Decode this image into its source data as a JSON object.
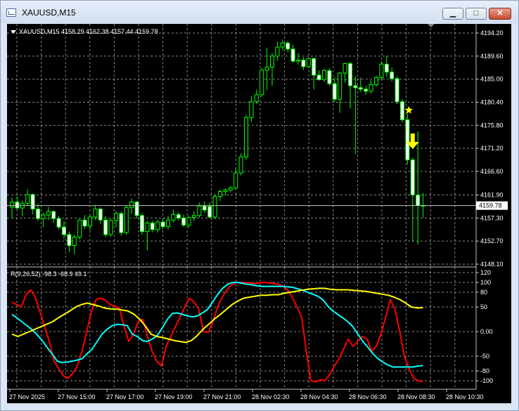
{
  "window": {
    "title": "XAUUSD,M15",
    "minimize_glyph": "▁",
    "maximize_glyph": "□",
    "close_glyph": "✕"
  },
  "chart_header": "XAUUSD,M15  4158.29 4162.38 4157.44 4159.78",
  "price_axis": {
    "ticks": [
      "4194.20",
      "4189.60",
      "4185.00",
      "4180.40",
      "4175.80",
      "4171.20",
      "4166.60",
      "4161.90",
      "4157.30",
      "4152.70",
      "4148.10"
    ],
    "current_price_label": "4159.78"
  },
  "indicator": {
    "label": "R(9,26,52) -98.3 -68.9 49.1",
    "ticks": [
      "120",
      "100",
      "80",
      "50",
      "0.00",
      "-50",
      "-80",
      "-100"
    ]
  },
  "time_axis": {
    "labels": [
      "27 Nov 2025",
      "27 Nov 15:00",
      "27 Nov 17:00",
      "27 Nov 19:00",
      "27 Nov 21:00",
      "28 Nov 02:30",
      "28 Nov 04:30",
      "28 Nov 06:30",
      "28 Nov 08:30",
      "28 Nov 10:30"
    ]
  },
  "colors": {
    "background": "#000000",
    "grid": "#c0c0c0",
    "candle": "#00ff00",
    "axis_text": "#ffffff",
    "line_fast": "#ff0000",
    "line_mid": "#00ffff",
    "line_slow": "#ffff00",
    "signal_marker": "#ffff00"
  },
  "chart_data": [
    {
      "type": "candlestick",
      "title": "XAUUSD,M15",
      "ylim": [
        4148.1,
        4194.2
      ],
      "current_price": 4159.78,
      "candles": [
        [
          4159.5,
          4161.4,
          4157.2,
          4160.5
        ],
        [
          4160.5,
          4161.6,
          4159.0,
          4159.3
        ],
        [
          4159.3,
          4160.8,
          4157.6,
          4160.2
        ],
        [
          4160.2,
          4163.0,
          4159.7,
          4162.0
        ],
        [
          4162.0,
          4162.2,
          4158.0,
          4159.1
        ],
        [
          4159.1,
          4160.1,
          4156.7,
          4157.2
        ],
        [
          4157.2,
          4158.4,
          4155.5,
          4157.9
        ],
        [
          4157.9,
          4159.5,
          4156.9,
          4158.6
        ],
        [
          4158.6,
          4158.9,
          4156.3,
          4157.2
        ],
        [
          4157.2,
          4157.8,
          4155.0,
          4155.5
        ],
        [
          4155.5,
          4156.7,
          4153.2,
          4154.0
        ],
        [
          4154.0,
          4154.6,
          4150.5,
          4151.8
        ],
        [
          4151.8,
          4154.0,
          4150.1,
          4153.5
        ],
        [
          4153.5,
          4157.1,
          4153.0,
          4156.9
        ],
        [
          4156.9,
          4157.9,
          4155.1,
          4155.7
        ],
        [
          4155.7,
          4158.0,
          4154.8,
          4157.5
        ],
        [
          4157.5,
          4159.9,
          4156.9,
          4159.1
        ],
        [
          4159.1,
          4159.4,
          4156.1,
          4156.9
        ],
        [
          4156.9,
          4157.7,
          4153.5,
          4154.0
        ],
        [
          4154.0,
          4157.2,
          4153.6,
          4156.8
        ],
        [
          4156.8,
          4158.7,
          4155.5,
          4158.2
        ],
        [
          4158.2,
          4158.6,
          4153.8,
          4154.4
        ],
        [
          4154.4,
          4159.9,
          4154.0,
          4159.4
        ],
        [
          4159.4,
          4161.2,
          4158.1,
          4160.5
        ],
        [
          4160.5,
          4160.7,
          4157.2,
          4157.8
        ],
        [
          4157.8,
          4158.3,
          4154.0,
          4154.6
        ],
        [
          4154.6,
          4156.7,
          4150.9,
          4156.3
        ],
        [
          4156.3,
          4156.8,
          4154.5,
          4155.0
        ],
        [
          4155.0,
          4157.0,
          4154.4,
          4156.5
        ],
        [
          4156.5,
          4157.2,
          4155.1,
          4155.6
        ],
        [
          4155.6,
          4157.7,
          4155.0,
          4156.9
        ],
        [
          4156.9,
          4159.0,
          4156.4,
          4158.0
        ],
        [
          4158.0,
          4158.5,
          4156.8,
          4157.3
        ],
        [
          4157.3,
          4158.0,
          4155.5,
          4155.9
        ],
        [
          4155.9,
          4157.8,
          4155.4,
          4157.4
        ],
        [
          4157.4,
          4158.7,
          4156.7,
          4157.8
        ],
        [
          4157.8,
          4160.4,
          4157.4,
          4159.7
        ],
        [
          4159.7,
          4160.6,
          4158.3,
          4158.9
        ],
        [
          4159.6,
          4160.4,
          4157.3,
          4157.5
        ],
        [
          4157.5,
          4162.0,
          4157.1,
          4161.6
        ],
        [
          4161.6,
          4163.0,
          4160.7,
          4162.6
        ],
        [
          4162.6,
          4163.2,
          4161.8,
          4162.9
        ],
        [
          4162.9,
          4163.7,
          4162.4,
          4163.3
        ],
        [
          4163.3,
          4167.2,
          4163.0,
          4166.3
        ],
        [
          4166.3,
          4170.2,
          4165.8,
          4169.5
        ],
        [
          4169.5,
          4177.9,
          4168.9,
          4177.3
        ],
        [
          4177.3,
          4181.6,
          4176.5,
          4180.5
        ],
        [
          4180.5,
          4182.9,
          4180.0,
          4181.9
        ],
        [
          4181.9,
          4187.2,
          4181.5,
          4186.8
        ],
        [
          4186.8,
          4191.3,
          4182.8,
          4187.4
        ],
        [
          4187.4,
          4190.2,
          4183.7,
          4189.6
        ],
        [
          4189.6,
          4192.5,
          4188.7,
          4191.4
        ],
        [
          4191.4,
          4192.9,
          4190.7,
          4192.2
        ],
        [
          4192.2,
          4192.6,
          4190.4,
          4191.0
        ],
        [
          4191.0,
          4191.8,
          4188.3,
          4188.6
        ],
        [
          4188.6,
          4190.2,
          4187.9,
          4188.8
        ],
        [
          4188.8,
          4189.4,
          4186.8,
          4187.5
        ],
        [
          4187.5,
          4189.4,
          4187.2,
          4189.1
        ],
        [
          4189.1,
          4189.3,
          4182.9,
          4185.8
        ],
        [
          4185.8,
          4186.8,
          4184.7,
          4184.9
        ],
        [
          4184.9,
          4187.1,
          4184.5,
          4186.7
        ],
        [
          4186.7,
          4187.2,
          4183.7,
          4184.1
        ],
        [
          4184.1,
          4185.4,
          4180.4,
          4181.0
        ],
        [
          4181.0,
          4186.5,
          4178.3,
          4186.2
        ],
        [
          4186.2,
          4188.3,
          4184.3,
          4188.1
        ],
        [
          4188.1,
          4188.5,
          4179.1,
          4183.7
        ],
        [
          4183.7,
          4185.6,
          4170.1,
          4183.3
        ],
        [
          4183.3,
          4185.3,
          4182.4,
          4183.0
        ],
        [
          4183.0,
          4183.7,
          4181.9,
          4182.6
        ],
        [
          4182.6,
          4184.8,
          4182.1,
          4183.9
        ],
        [
          4183.9,
          4185.7,
          4183.5,
          4185.3
        ],
        [
          4185.3,
          4188.5,
          4184.9,
          4188.0
        ],
        [
          4188.0,
          4189.7,
          4185.4,
          4186.4
        ],
        [
          4186.4,
          4187.3,
          4184.5,
          4185.1
        ],
        [
          4185.1,
          4185.6,
          4180.0,
          4180.5
        ],
        [
          4180.5,
          4181.0,
          4176.4,
          4176.9
        ],
        [
          4176.9,
          4178.1,
          4168.0,
          4168.9
        ],
        [
          4168.9,
          4169.4,
          4152.6,
          4161.9
        ],
        [
          4161.9,
          4174.6,
          4152.0,
          4159.8
        ],
        [
          4159.8,
          4162.3,
          4157.4,
          4159.8
        ]
      ],
      "signal_markers": [
        {
          "kind": "arrow-down",
          "index": 77
        },
        {
          "kind": "star",
          "index": 76
        }
      ]
    },
    {
      "type": "line",
      "title": "R(9,26,52) -98.3 -68.9 49.1",
      "ylim": [
        -110,
        120
      ],
      "series": [
        {
          "name": "R9",
          "values": [
            60,
            55,
            50,
            75,
            85,
            70,
            40,
            10,
            -20,
            -60,
            -75,
            -90,
            -95,
            -85,
            -70,
            -40,
            0,
            40,
            65,
            68,
            64,
            55,
            52,
            48,
            10,
            -20,
            -5,
            20,
            25,
            -10,
            -40,
            -60,
            -70,
            -30,
            -10,
            10,
            30,
            50,
            68,
            60,
            45,
            0,
            -2,
            20,
            50,
            70,
            85,
            95,
            100,
            100,
            100,
            99,
            98,
            99,
            100,
            99,
            98,
            96,
            92,
            85,
            70,
            50,
            30,
            -40,
            -100,
            -102,
            -98,
            -100,
            -88,
            -70,
            -55,
            -35,
            -15,
            -30,
            -20,
            -10,
            -15,
            -40,
            -30,
            -5,
            30,
            65,
            45,
            0,
            -50,
            -75,
            -95,
            -100,
            -102
          ]
        },
        {
          "name": "R26",
          "values": [
            35,
            28,
            20,
            12,
            4,
            -6,
            -18,
            -32,
            -45,
            -60,
            -63,
            -62,
            -60,
            -58,
            -55,
            -45,
            -35,
            -20,
            -5,
            5,
            12,
            15,
            14,
            12,
            -5,
            -10,
            -18,
            -20,
            -15,
            -8,
            8,
            25,
            37,
            38,
            35,
            32,
            30,
            32,
            38,
            45,
            60,
            75,
            88,
            96,
            100,
            100,
            98,
            96,
            95,
            93,
            92,
            92,
            92,
            92,
            92,
            91,
            90,
            87,
            84,
            80,
            76,
            72,
            65,
            52,
            42,
            35,
            28,
            20,
            10,
            -5,
            -20,
            -32,
            -45,
            -55,
            -62,
            -68,
            -72,
            -72,
            -72,
            -72,
            -72,
            -70,
            -69
          ]
        },
        {
          "name": "R52",
          "values": [
            -5,
            -10,
            -5,
            0,
            5,
            10,
            15,
            20,
            28,
            35,
            42,
            50,
            55,
            58,
            55,
            52,
            48,
            46,
            46,
            44,
            42,
            36,
            26,
            12,
            -5,
            -10,
            -12,
            -15,
            -18,
            -20,
            -22,
            -18,
            -8,
            5,
            15,
            26,
            35,
            45,
            55,
            62,
            68,
            70,
            72,
            74,
            74,
            75,
            75,
            78,
            80,
            82,
            84,
            86,
            87,
            88,
            88,
            86,
            85,
            85,
            85,
            84,
            83,
            82,
            80,
            78,
            76,
            74,
            70,
            65,
            58,
            50,
            48,
            49
          ]
        }
      ],
      "reference_lines": [
        100,
        80,
        50,
        0,
        -50,
        -80,
        -100
      ]
    }
  ]
}
